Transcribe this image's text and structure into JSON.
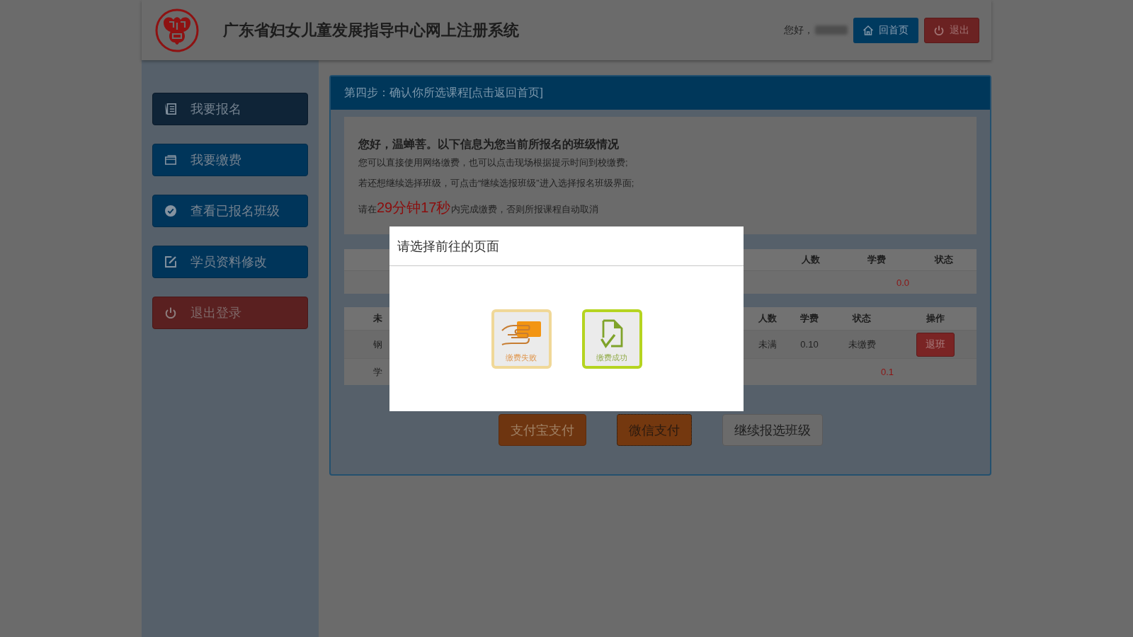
{
  "header": {
    "title": "广东省妇女儿童发展指导中心网上注册系统",
    "greeting": "您好，",
    "buttons": [
      {
        "label": "回首页",
        "kind": "home"
      },
      {
        "label": "退出",
        "kind": "exit"
      }
    ]
  },
  "sidebar": {
    "items": [
      {
        "label": "我要报名",
        "kind": "signup",
        "selected": true
      },
      {
        "label": "我要缴费",
        "kind": "pay",
        "selected": false
      },
      {
        "label": "查看已报名班级",
        "kind": "classes",
        "selected": false
      },
      {
        "label": "学员资料修改",
        "kind": "profile",
        "selected": false
      },
      {
        "label": "退出登录",
        "kind": "logout",
        "selected": false
      }
    ]
  },
  "panel": {
    "title": "第四步：确认你所选课程[点击返回首页]",
    "notice": {
      "heading": "您好，温蝉菩。以下信息为您当前所报名的班级情况",
      "lines": [
        "您可以直接使用网络缴费，也可以点击现场根据提示时间到校缴费;",
        "若还想继续选择班级，可点击“继续选报班级”进入选择报名班级界面;"
      ],
      "countdown": {
        "before": "请在",
        "time": "29分钟17秒",
        "after": "内完成缴费，否则所报课程自动取消"
      }
    },
    "summary_table": {
      "columns": [
        "人数",
        "学费",
        "状态"
      ],
      "total": "0.0"
    },
    "class_table": {
      "columns": [
        "未",
        "人数",
        "学费",
        "状态",
        "操作"
      ],
      "rows": [
        {
          "cells": [
            "钢",
            "未满",
            "0.10",
            "未缴费"
          ],
          "action": "退班"
        }
      ],
      "total": {
        "label": "学",
        "value": "0.1"
      }
    },
    "actions": [
      {
        "label": "支付宝支付",
        "kind": "payment",
        "focused": false
      },
      {
        "label": "微信支付",
        "kind": "payment",
        "focused": true
      },
      {
        "label": "继续报选班级",
        "kind": "plain",
        "focused": false
      }
    ]
  },
  "modal": {
    "title": "请选择前往的页面",
    "options": [
      {
        "label": "缴费失败",
        "kind": "failed"
      },
      {
        "label": "缴费成功",
        "kind": "success"
      }
    ]
  }
}
